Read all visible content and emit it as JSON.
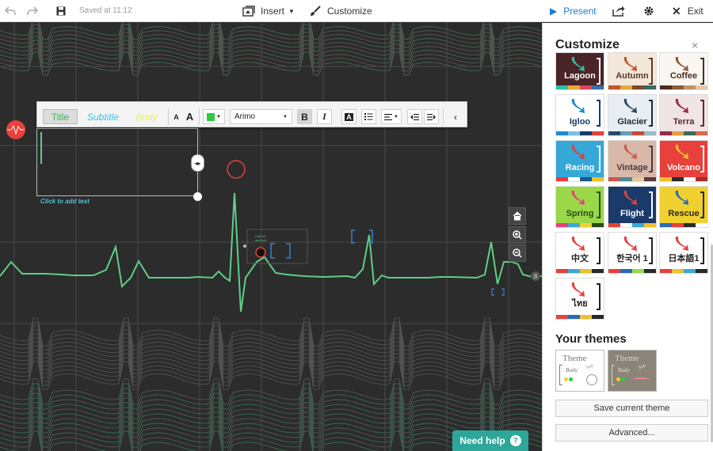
{
  "toolbar": {
    "saved_text": "Saved at 11:12",
    "insert_label": "Insert",
    "customize_label": "Customize",
    "present_label": "Present",
    "exit_label": "Exit"
  },
  "text_toolbar": {
    "style_tabs": [
      "Title",
      "Subtitle",
      "Body"
    ],
    "font_name": "Arimo",
    "color_value": "#2ecc40"
  },
  "canvas": {
    "click_to_add_text": "Click to add text",
    "frame_badge": "8"
  },
  "help": {
    "label": "Need help",
    "icon": "?"
  },
  "sidebar": {
    "title": "Customize",
    "close_icon": "×",
    "themes": [
      {
        "name": "Lagoon",
        "bg": "#4a2426",
        "fg": "#ffffff",
        "accent": "#2bc0a9",
        "stripe": [
          "#2bc0a9",
          "#e8a83c",
          "#d8465a",
          "#3b6ea8"
        ]
      },
      {
        "name": "Autumn",
        "bg": "#f2e7d9",
        "fg": "#5a3a2a",
        "accent": "#c0562a",
        "stripe": [
          "#c0562a",
          "#e3a73a",
          "#7a4a2a",
          "#3a6a5a"
        ]
      },
      {
        "name": "Coffee",
        "bg": "#faf6f1",
        "fg": "#4a2e1e",
        "accent": "#8a5a3a",
        "stripe": [
          "#4a2e1e",
          "#8a5a3a",
          "#c4926a",
          "#e0c9a8"
        ]
      },
      {
        "name": "Igloo",
        "bg": "#ffffff",
        "fg": "#1a3a6a",
        "accent": "#1a8ad0",
        "stripe": [
          "#1a8ad0",
          "#7ac0e8",
          "#1a3a6a",
          "#e8403a"
        ]
      },
      {
        "name": "Glacier",
        "bg": "#e8eef3",
        "fg": "#1a2a3a",
        "accent": "#2a4a6a",
        "stripe": [
          "#2a4a6a",
          "#6a9ab8",
          "#c84a3a",
          "#9ab8c8"
        ]
      },
      {
        "name": "Terra",
        "bg": "#f0e4e4",
        "fg": "#5a2a3a",
        "accent": "#9a2a4a",
        "stripe": [
          "#9a2a4a",
          "#e0a040",
          "#3a6a5a",
          "#d46a4a"
        ]
      },
      {
        "name": "Racing",
        "bg": "#35a8d8",
        "fg": "#ffffff",
        "accent": "#e83a3a",
        "stripe": [
          "#e83a3a",
          "#ffffff",
          "#1a5a8a",
          "#f0c030"
        ]
      },
      {
        "name": "Vintage",
        "bg": "#d8b8a8",
        "fg": "#4a3a3a",
        "accent": "#c85a4a",
        "stripe": [
          "#c85a4a",
          "#4a8a9a",
          "#e8c898",
          "#5a3a3a"
        ]
      },
      {
        "name": "Volcano",
        "bg": "#e8403a",
        "fg": "#ffffff",
        "accent": "#f0c030",
        "stripe": [
          "#f0c030",
          "#2a2a2a",
          "#ffffff",
          "#a82a2a"
        ]
      },
      {
        "name": "Spring",
        "bg": "#9ad848",
        "fg": "#2a4a1a",
        "accent": "#e8407a",
        "stripe": [
          "#e8407a",
          "#3aa8d8",
          "#f0d030",
          "#2a4a1a"
        ]
      },
      {
        "name": "Flight",
        "bg": "#1a3a6a",
        "fg": "#ffffff",
        "accent": "#e8403a",
        "stripe": [
          "#e8403a",
          "#ffffff",
          "#3aa8d8",
          "#f0c030"
        ]
      },
      {
        "name": "Rescue",
        "bg": "#f0d030",
        "fg": "#2a2a2a",
        "accent": "#2a6ab8",
        "stripe": [
          "#2a6ab8",
          "#e8403a",
          "#2a2a2a",
          "#ffffff"
        ]
      },
      {
        "name": "中文",
        "bg": "#ffffff",
        "fg": "#222222",
        "accent": "#e8403a",
        "stripe": [
          "#e8403a",
          "#3aa8d8",
          "#f0c030",
          "#2a2a2a"
        ]
      },
      {
        "name": "한국어 1",
        "bg": "#ffffff",
        "fg": "#222222",
        "accent": "#e8403a",
        "stripe": [
          "#e8403a",
          "#2a6ab8",
          "#9ad848",
          "#2a2a2a"
        ]
      },
      {
        "name": "日本語1",
        "bg": "#ffffff",
        "fg": "#222222",
        "accent": "#e8403a",
        "stripe": [
          "#e8403a",
          "#f0c030",
          "#3aa8d8",
          "#2a2a2a"
        ]
      },
      {
        "name": "ไทย",
        "bg": "#ffffff",
        "fg": "#222222",
        "accent": "#e8403a",
        "stripe": [
          "#e8403a",
          "#2a6ab8",
          "#f0c030",
          "#2a2a2a"
        ]
      }
    ],
    "your_themes_title": "Your themes",
    "user_themes": [
      {
        "theme_word": "Theme",
        "body_word": "Body",
        "sub_word": "Sub",
        "bg": "#ffffff"
      },
      {
        "theme_word": "Theme",
        "body_word": "Body",
        "sub_word": "Sub",
        "bg": "#8a8578"
      }
    ],
    "save_label": "Save current theme",
    "advanced_label": "Advanced..."
  }
}
